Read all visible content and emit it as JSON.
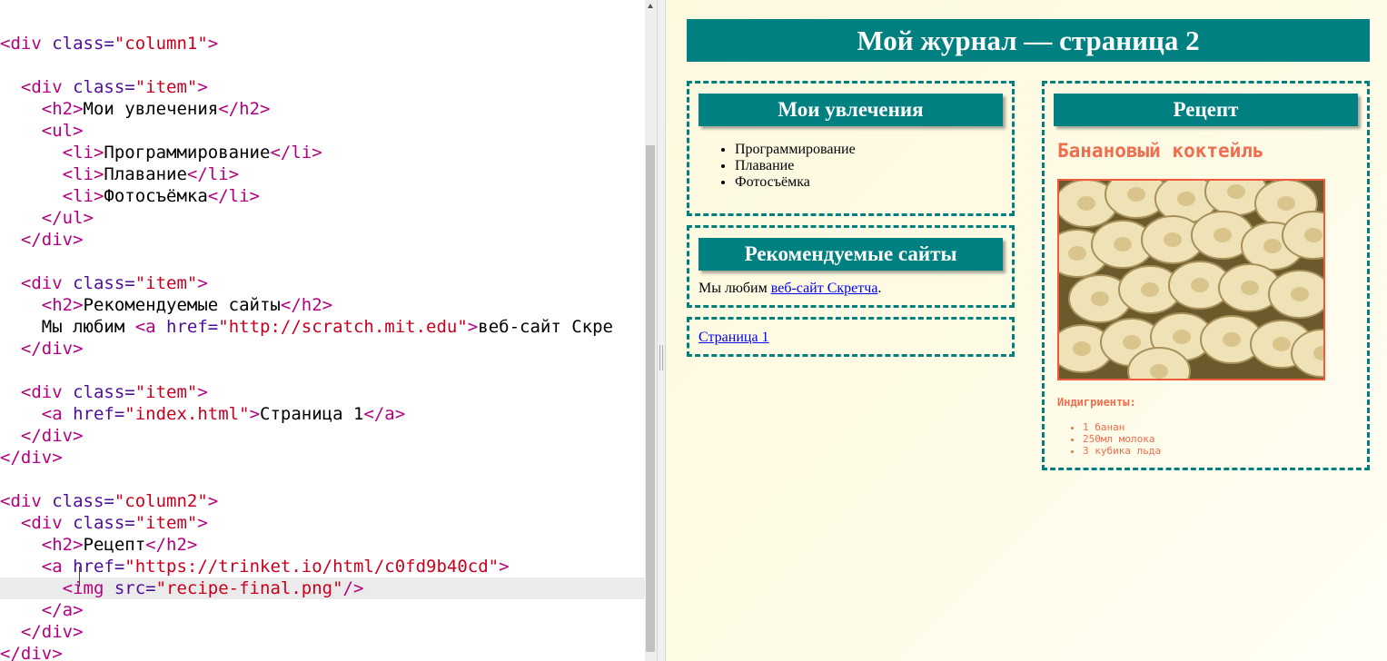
{
  "editor": {
    "lines": [
      [],
      [
        [
          "tag",
          "<div "
        ],
        [
          "attr",
          "class="
        ],
        [
          "str",
          "\"column1\""
        ],
        [
          "tag",
          ">"
        ]
      ],
      [],
      [
        [
          "text",
          "  "
        ],
        [
          "tag",
          "<div "
        ],
        [
          "attr",
          "class="
        ],
        [
          "str",
          "\"item\""
        ],
        [
          "tag",
          ">"
        ]
      ],
      [
        [
          "text",
          "    "
        ],
        [
          "tag",
          "<h2>"
        ],
        [
          "text",
          "Мои увлечения"
        ],
        [
          "tag",
          "</h2>"
        ]
      ],
      [
        [
          "text",
          "    "
        ],
        [
          "tag",
          "<ul>"
        ]
      ],
      [
        [
          "text",
          "      "
        ],
        [
          "tag",
          "<li>"
        ],
        [
          "text",
          "Программирование"
        ],
        [
          "tag",
          "</li>"
        ]
      ],
      [
        [
          "text",
          "      "
        ],
        [
          "tag",
          "<li>"
        ],
        [
          "text",
          "Плавание"
        ],
        [
          "tag",
          "</li>"
        ]
      ],
      [
        [
          "text",
          "      "
        ],
        [
          "tag",
          "<li>"
        ],
        [
          "text",
          "Фотосъёмка"
        ],
        [
          "tag",
          "</li>"
        ]
      ],
      [
        [
          "text",
          "    "
        ],
        [
          "tag",
          "</ul>"
        ]
      ],
      [
        [
          "text",
          "  "
        ],
        [
          "tag",
          "</div>"
        ]
      ],
      [],
      [
        [
          "text",
          "  "
        ],
        [
          "tag",
          "<div "
        ],
        [
          "attr",
          "class="
        ],
        [
          "str",
          "\"item\""
        ],
        [
          "tag",
          ">"
        ]
      ],
      [
        [
          "text",
          "    "
        ],
        [
          "tag",
          "<h2>"
        ],
        [
          "text",
          "Рекомендуемые сайты"
        ],
        [
          "tag",
          "</h2>"
        ]
      ],
      [
        [
          "text",
          "    Мы любим "
        ],
        [
          "tag",
          "<a "
        ],
        [
          "attr",
          "href="
        ],
        [
          "str",
          "\"http://scratch.mit.edu\""
        ],
        [
          "tag",
          ">"
        ],
        [
          "text",
          "веб-сайт Скре"
        ]
      ],
      [
        [
          "text",
          "  "
        ],
        [
          "tag",
          "</div>"
        ]
      ],
      [],
      [
        [
          "text",
          "  "
        ],
        [
          "tag",
          "<div "
        ],
        [
          "attr",
          "class="
        ],
        [
          "str",
          "\"item\""
        ],
        [
          "tag",
          ">"
        ]
      ],
      [
        [
          "text",
          "    "
        ],
        [
          "tag",
          "<a "
        ],
        [
          "attr",
          "href="
        ],
        [
          "str",
          "\"index.html\""
        ],
        [
          "tag",
          ">"
        ],
        [
          "text",
          "Страница 1"
        ],
        [
          "tag",
          "</a>"
        ]
      ],
      [
        [
          "text",
          "  "
        ],
        [
          "tag",
          "</div>"
        ]
      ],
      [
        [
          "tag",
          "</div>"
        ]
      ],
      [],
      [
        [
          "tag",
          "<div "
        ],
        [
          "attr",
          "class="
        ],
        [
          "str",
          "\"column2\""
        ],
        [
          "tag",
          ">"
        ]
      ],
      [
        [
          "text",
          "  "
        ],
        [
          "tag",
          "<div "
        ],
        [
          "attr",
          "class="
        ],
        [
          "str",
          "\"item\""
        ],
        [
          "tag",
          ">"
        ]
      ],
      [
        [
          "text",
          "    "
        ],
        [
          "tag",
          "<h2>"
        ],
        [
          "text",
          "Рецепт"
        ],
        [
          "tag",
          "</h2>"
        ]
      ],
      [
        [
          "text",
          "    "
        ],
        [
          "tag",
          "<a "
        ],
        [
          "attr",
          "href="
        ],
        [
          "str",
          "\"https://trinket.io/html/c0fd9b40cd\""
        ],
        [
          "tag",
          ">"
        ]
      ],
      [
        [
          "text",
          "      "
        ],
        [
          "tag",
          "<img "
        ],
        [
          "attr",
          "src="
        ],
        [
          "str",
          "\"recipe-final.png\""
        ],
        [
          "tag",
          "/>"
        ]
      ],
      [
        [
          "text",
          "    "
        ],
        [
          "tag",
          "</a>"
        ]
      ],
      [
        [
          "text",
          "  "
        ],
        [
          "tag",
          "</div>"
        ]
      ],
      [
        [
          "tag",
          "</div>"
        ]
      ]
    ],
    "active_line": 26
  },
  "preview": {
    "title": "Мой журнал — страница 2",
    "hobbies": {
      "heading": "Мои увлечения",
      "items": [
        "Программирование",
        "Плавание",
        "Фотосъёмка"
      ]
    },
    "sites": {
      "heading": "Рекомендуемые сайты",
      "text_before": "Мы любим ",
      "link": "веб-сайт Скретча",
      "text_after": "."
    },
    "page_link": "Страница 1",
    "recipe": {
      "heading": "Рецепт",
      "name": "Банановый коктейль",
      "image_icon": "banana-slices-photo",
      "ingredients_label": "Индигриенты:",
      "ingredients": [
        "1 банан",
        "250мл молока",
        "3 кубика льда"
      ]
    }
  },
  "colors": {
    "teal": "#008080",
    "recipe_accent": "#f06d4e",
    "link": "#0000ee"
  }
}
